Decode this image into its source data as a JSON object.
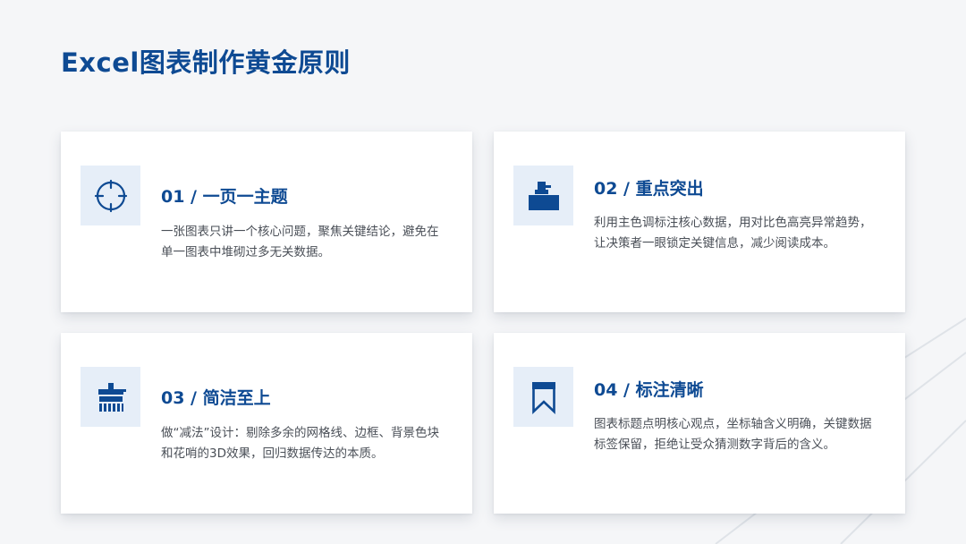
{
  "title": "Excel图表制作黄金原则",
  "colors": {
    "accent": "#0e4a93",
    "icon_bg": "#e6eef8",
    "text": "#4a4f57",
    "background": "#f5f6f8"
  },
  "cards": [
    {
      "title": "01 / 一页一主题",
      "desc": "一张图表只讲一个核心问题，聚焦关键结论，避免在单一图表中堆砌过多无关数据。",
      "icon": "crosshair-icon"
    },
    {
      "title": "02 / 重点突出",
      "desc": "利用主色调标注核心数据，用对比色高亮异常趋势，让决策者一眼锁定关键信息，减少阅读成本。",
      "icon": "stamp-icon"
    },
    {
      "title": "03 / 简洁至上",
      "desc": "做“减法”设计：剔除多余的网格线、边框、背景色块和花哨的3D效果，回归数据传达的本质。",
      "icon": "brush-icon"
    },
    {
      "title": "04 / 标注清晰",
      "desc": "图表标题点明核心观点，坐标轴含义明确，关键数据标签保留，拒绝让受众猜测数字背后的含义。",
      "icon": "bookmark-icon"
    }
  ]
}
